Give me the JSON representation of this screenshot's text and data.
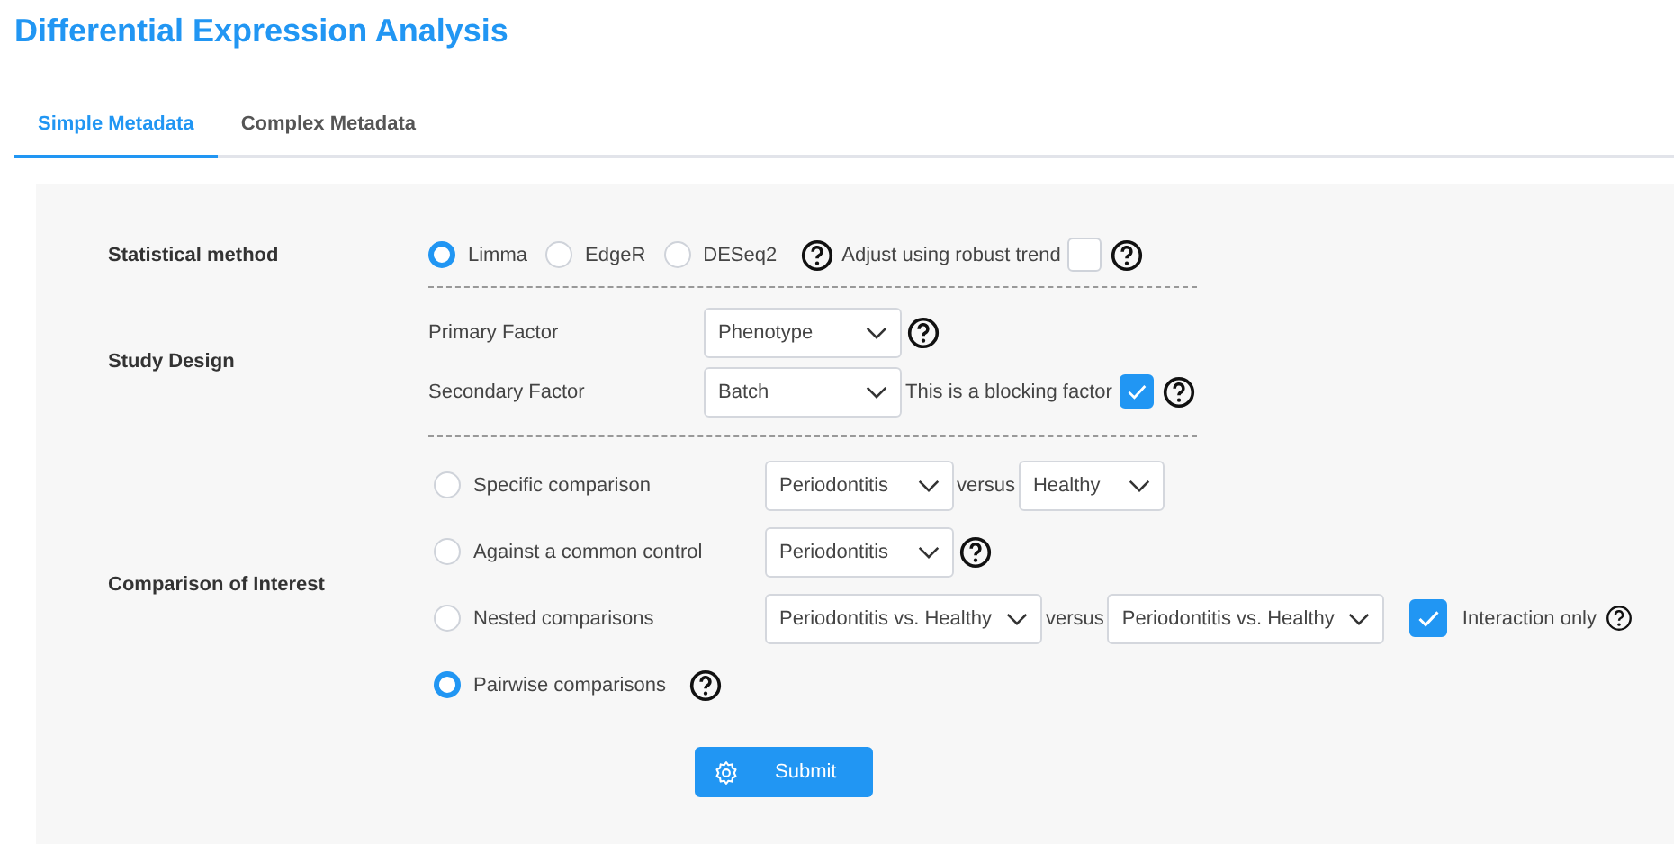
{
  "title": "Differential Expression Analysis",
  "tabs": [
    {
      "label": "Simple Metadata",
      "selected": true
    },
    {
      "label": "Complex Metadata",
      "selected": false
    }
  ],
  "statistical_method": {
    "label": "Statistical method",
    "options": [
      {
        "label": "Limma",
        "selected": true
      },
      {
        "label": "EdgeR",
        "selected": false
      },
      {
        "label": "DESeq2",
        "selected": false
      }
    ],
    "robust_trend": {
      "label": "Adjust using robust trend",
      "checked": false
    }
  },
  "study_design": {
    "label": "Study Design",
    "factors": [
      {
        "label": "Primary Factor",
        "value": "Phenotype",
        "help": true
      },
      {
        "label": "Secondary Factor",
        "value": "Batch",
        "help": false,
        "blocking": {
          "label": "This is a blocking factor",
          "checked": true
        }
      }
    ]
  },
  "comparison": {
    "label": "Comparison of Interest",
    "options": [
      {
        "label": "Specific comparison",
        "selected": false,
        "help": false,
        "selects": [
          {
            "value": "Periodontitis"
          },
          {
            "value": "Healthy"
          }
        ],
        "connector": "versus"
      },
      {
        "label": "Against a common control",
        "selected": false,
        "help": true,
        "selects": [
          {
            "value": "Periodontitis"
          }
        ]
      },
      {
        "label": "Nested comparisons",
        "selected": false,
        "help": false,
        "selects": [
          {
            "value": "Periodontitis vs. Healthy"
          },
          {
            "value": "Periodontitis vs. Healthy"
          }
        ],
        "connector": "versus",
        "interaction": {
          "label": "Interaction only",
          "checked": true
        }
      },
      {
        "label": "Pairwise comparisons",
        "selected": true,
        "help": true
      }
    ]
  },
  "submit": "Submit"
}
